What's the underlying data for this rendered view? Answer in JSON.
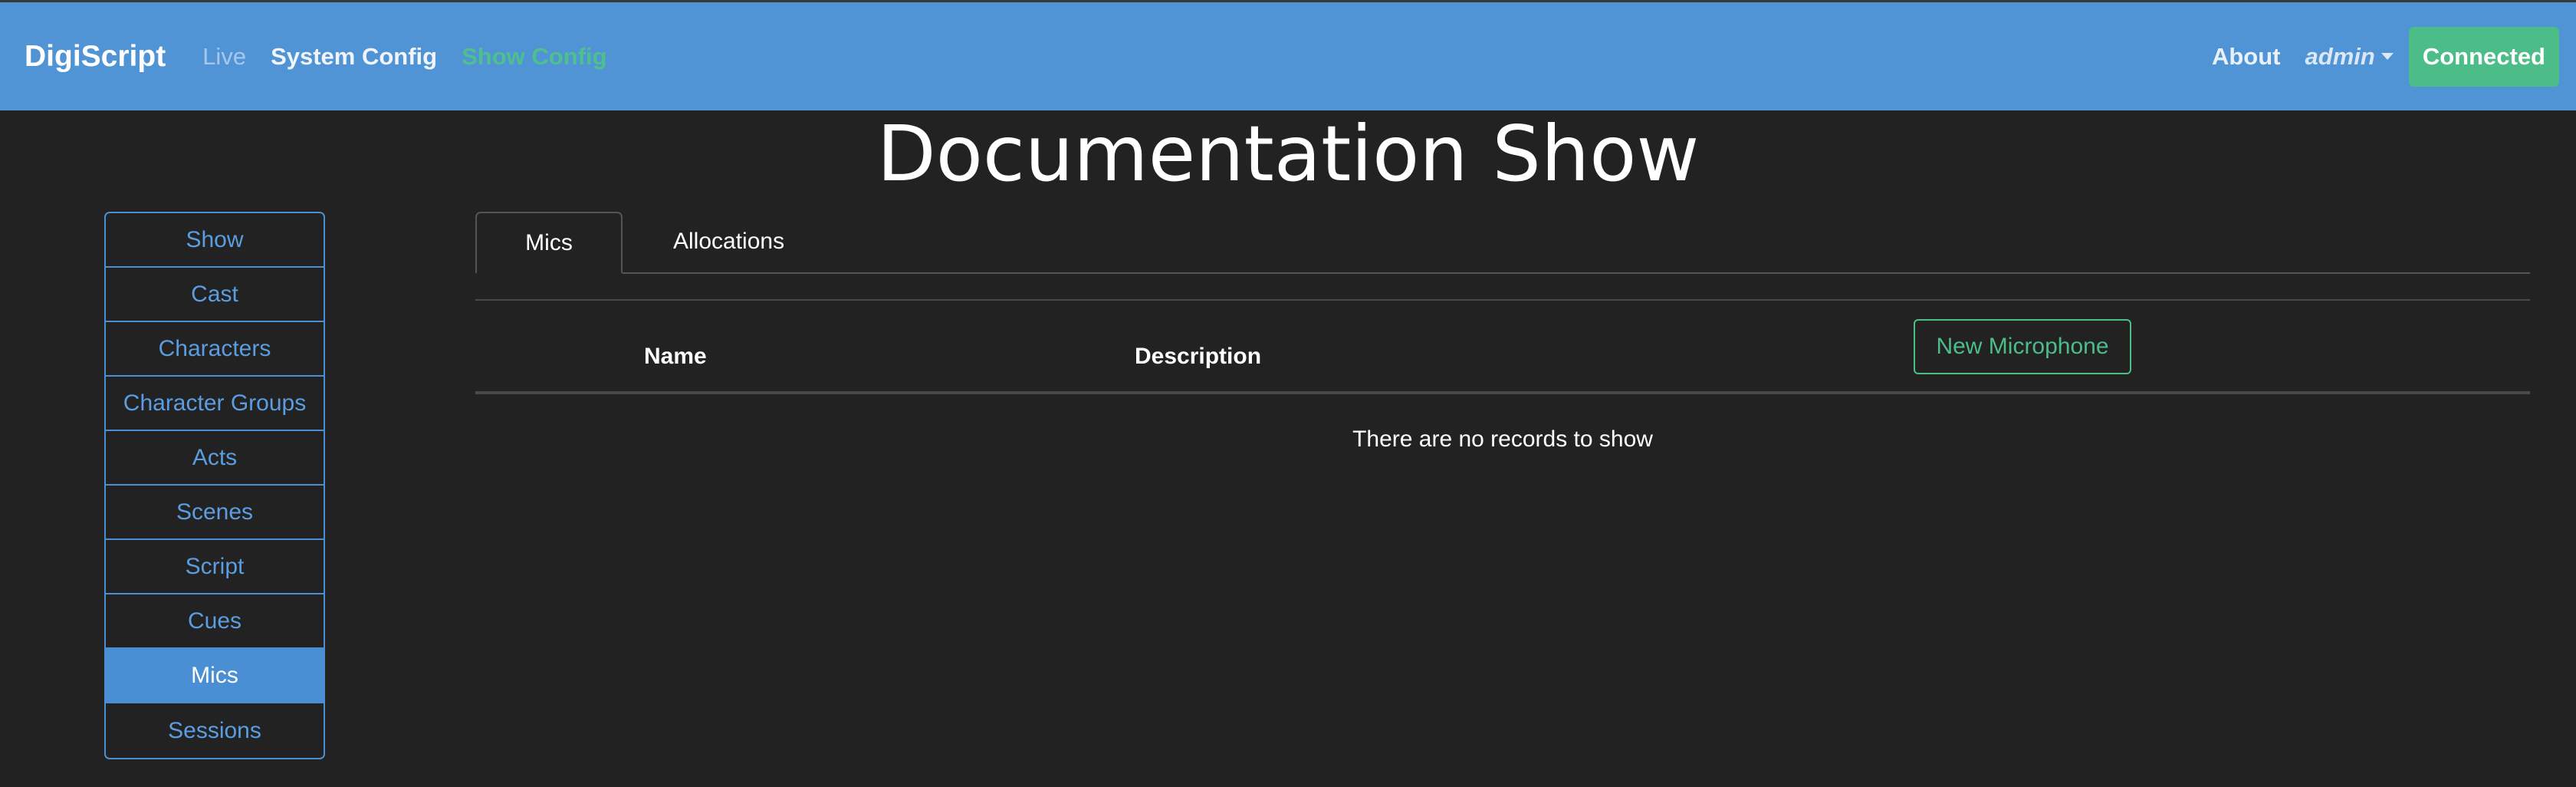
{
  "navbar": {
    "brand": "DigiScript",
    "links": {
      "live": "Live",
      "system_config": "System Config",
      "show_config": "Show Config"
    },
    "about": "About",
    "user": "admin",
    "status": "Connected",
    "colors": {
      "bar": "#5094d6",
      "active_link": "#4fbf8d",
      "status_bg": "#4cbc89"
    }
  },
  "page": {
    "title": "Documentation Show"
  },
  "sidebar": {
    "items": [
      {
        "label": "Show"
      },
      {
        "label": "Cast"
      },
      {
        "label": "Characters"
      },
      {
        "label": "Character Groups"
      },
      {
        "label": "Acts"
      },
      {
        "label": "Scenes"
      },
      {
        "label": "Script"
      },
      {
        "label": "Cues"
      },
      {
        "label": "Mics"
      },
      {
        "label": "Sessions"
      }
    ],
    "active": "Mics"
  },
  "main": {
    "tabs": [
      {
        "label": "Mics"
      },
      {
        "label": "Allocations"
      }
    ],
    "active_tab": "Mics",
    "table": {
      "columns": [
        "Name",
        "Description"
      ],
      "new_button": "New Microphone",
      "empty_text": "There are no records to show"
    }
  }
}
